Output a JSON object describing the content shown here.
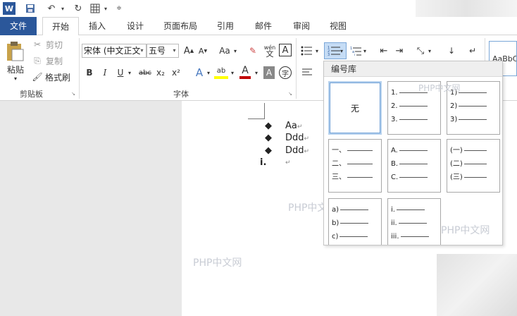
{
  "quick_access": {
    "word_icon": "word-logo-icon",
    "save_icon": "save-icon",
    "undo_icon": "undo-icon",
    "redo_icon": "redo-icon",
    "table_icon": "table-icon",
    "customize_icon": "customize-icon"
  },
  "tabs": [
    "文件",
    "开始",
    "插入",
    "设计",
    "页面布局",
    "引用",
    "邮件",
    "审阅",
    "视图"
  ],
  "active_tab": "开始",
  "clipboard": {
    "paste": "粘贴",
    "cut": "剪切",
    "copy": "复制",
    "format_painter": "格式刷",
    "label": "剪贴板"
  },
  "font": {
    "family": "宋体 (中文正文",
    "size": "五号",
    "label": "字体",
    "grow": "A",
    "shrink": "A",
    "case": "Aa",
    "clear": "A",
    "phonetic_top": "wén",
    "phonetic_bottom": "文",
    "border": "A",
    "bold": "B",
    "italic": "I",
    "underline": "U",
    "strike": "abc",
    "sub": "x₂",
    "sup": "x²",
    "effects": "A",
    "highlight": "ab",
    "color": "A",
    "shading": "A",
    "enclose": "字"
  },
  "styles": {
    "preview": "AaBbC"
  },
  "document": {
    "bullets": [
      {
        "marker": "◆",
        "text": "Aa"
      },
      {
        "marker": "◆",
        "text": "Ddd"
      },
      {
        "marker": "◆",
        "text": "Ddd"
      }
    ],
    "numbered": {
      "marker": "i.",
      "text": ""
    },
    "para_mark": "↵"
  },
  "numbering_library": {
    "title": "编号库",
    "none_label": "无",
    "cells": [
      {
        "lines": [
          "1.",
          "2.",
          "3."
        ]
      },
      {
        "lines": [
          "1)",
          "2)",
          "3)"
        ]
      },
      {
        "lines": [
          "一、",
          "二、",
          "三、"
        ]
      },
      {
        "lines": [
          "A.",
          "B.",
          "C."
        ]
      },
      {
        "lines": [
          "(一)",
          "(二)",
          "(三)"
        ]
      },
      {
        "lines": [
          "a)",
          "b)",
          "c)"
        ]
      },
      {
        "lines": [
          "i.",
          "ii.",
          "iii."
        ]
      }
    ]
  },
  "watermarks": [
    "PHP中文网",
    "PHP中文网",
    "PHP中文网",
    "PHP中文网"
  ],
  "colors": {
    "file_tab": "#2b579a",
    "highlight": "#ffff00",
    "font_color": "#c00000"
  }
}
